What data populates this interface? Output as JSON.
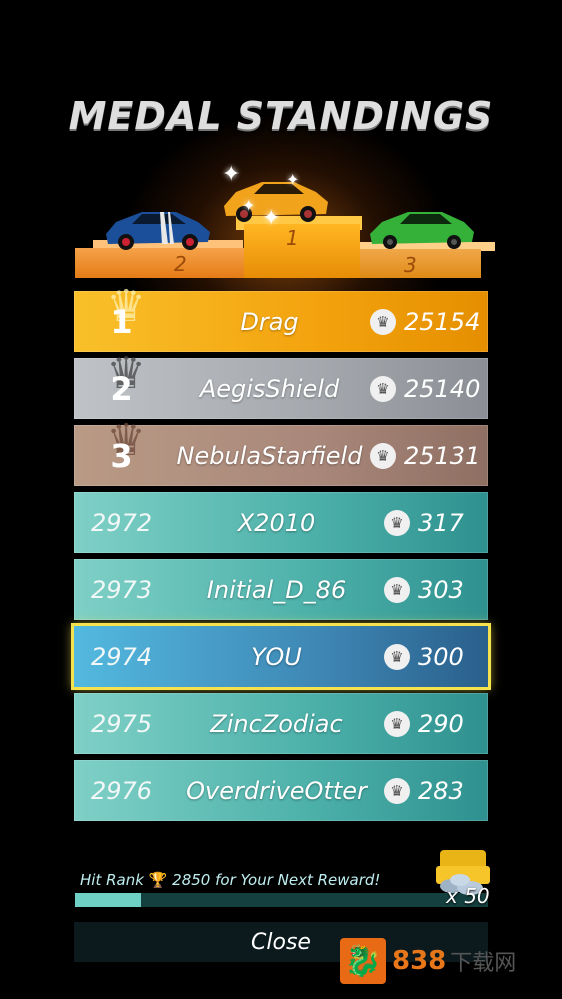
{
  "title": "MEDAL STANDINGS",
  "podium": {
    "first": "1",
    "second": "2",
    "third": "3"
  },
  "top_rows": [
    {
      "rank": "1",
      "name": "Drag",
      "score": "25154"
    },
    {
      "rank": "2",
      "name": "AegisShield",
      "score": "25140"
    },
    {
      "rank": "3",
      "name": "NebulaStarfield",
      "score": "25131"
    }
  ],
  "rows": [
    {
      "rank": "2972",
      "name": "X2010",
      "score": "317"
    },
    {
      "rank": "2973",
      "name": "Initial_D_86",
      "score": "303"
    },
    {
      "rank": "2974",
      "name": "YOU",
      "score": "300"
    },
    {
      "rank": "2975",
      "name": "ZincZodiac",
      "score": "290"
    },
    {
      "rank": "2976",
      "name": "OverdriveOtter",
      "score": "283"
    }
  ],
  "reward": {
    "prefix": "Hit Rank",
    "rank": "2850",
    "suffix": "for Your Next Reward!",
    "progress": 0.16,
    "multiplier": "x 50"
  },
  "close_label": "Close",
  "watermark": {
    "number": "838",
    "site": "下载网"
  },
  "icons": {
    "crown": "crown-icon",
    "trophy": "trophy-icon",
    "chest": "coin-chest-icon"
  },
  "colors": {
    "gold": "#f3a20d",
    "silver": "#a4a8ad",
    "bronze": "#a8877a",
    "teal": "#4eb2ab",
    "you": "#3e86b4",
    "highlight": "#f6e24c"
  }
}
